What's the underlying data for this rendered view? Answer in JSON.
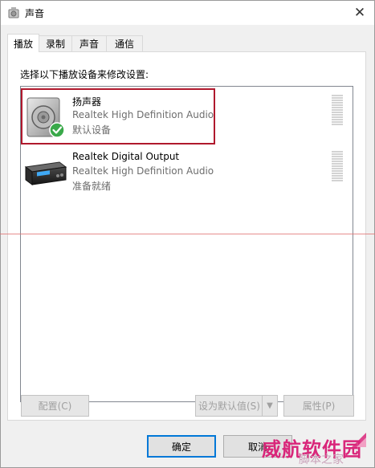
{
  "window": {
    "title": "声音",
    "title_icon": "speaker-icon",
    "close_glyph": "✕"
  },
  "tabs": [
    {
      "label": "播放",
      "active": true
    },
    {
      "label": "录制",
      "active": false
    },
    {
      "label": "声音",
      "active": false
    },
    {
      "label": "通信",
      "active": false
    }
  ],
  "panel": {
    "instruction": "选择以下播放设备来修改设置:"
  },
  "devices": [
    {
      "name": "扬声器",
      "description": "Realtek High Definition Audio",
      "status": "默认设备",
      "icon": "speaker-default-icon",
      "is_default": true
    },
    {
      "name": "Realtek Digital Output",
      "description": "Realtek High Definition Audio",
      "status": "准备就绪",
      "icon": "digital-output-icon",
      "is_default": false
    }
  ],
  "buttons": {
    "configure": "配置(C)",
    "set_default": "设为默认值(S)",
    "set_default_arrow": "▼",
    "properties": "属性(P)",
    "ok": "确定",
    "cancel": "取消"
  },
  "watermark": {
    "main": "威航软件园",
    "sub": "脚本之家"
  },
  "colors": {
    "highlight_frame": "#b0192d",
    "default_check": "#2ea043",
    "primary_border": "#0078d7"
  }
}
